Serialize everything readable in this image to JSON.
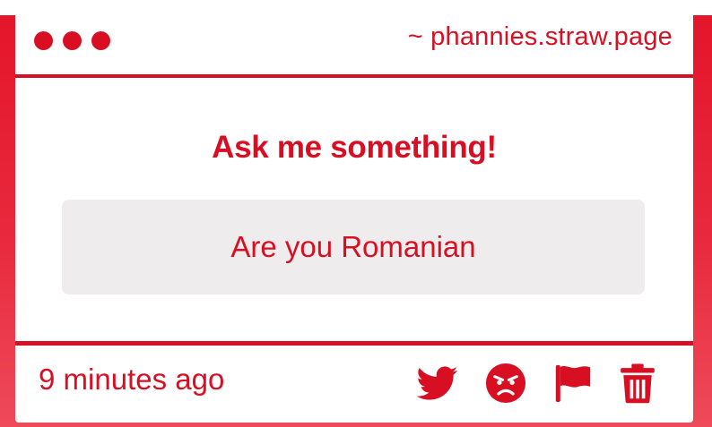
{
  "window": {
    "url": "~ phannies.straw.page"
  },
  "main": {
    "heading": "Ask me something!",
    "question": "Are you Romanian"
  },
  "footer": {
    "timestamp": "9 minutes ago",
    "actions": [
      {
        "icon": "twitter-icon"
      },
      {
        "icon": "angry-face-icon"
      },
      {
        "icon": "flag-icon"
      },
      {
        "icon": "trash-icon"
      }
    ]
  },
  "colors": {
    "accent": "#d80f23",
    "question_bg": "#eeecec",
    "background": "#e8293d"
  }
}
